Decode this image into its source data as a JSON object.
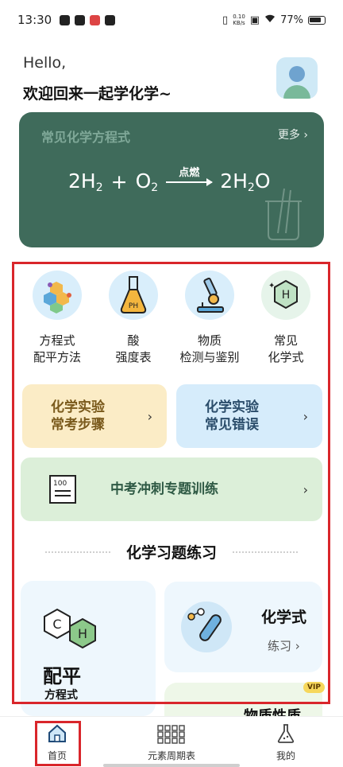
{
  "status_bar": {
    "time": "13:30",
    "net_speed_value": "0.10",
    "net_speed_unit": "KB/s",
    "battery": "77%"
  },
  "greeting": {
    "hello": "Hello,",
    "welcome": "欢迎回来一起学化学~"
  },
  "banner": {
    "title": "常见化学方程式",
    "more": "更多 ›",
    "condition": "点燃",
    "lhs1": "2H",
    "lhs1_sub": "2",
    "plus": "+",
    "lhs2": "O",
    "lhs2_sub": "2",
    "rhs": "2H",
    "rhs_sub": "2",
    "rhs_tail": "O"
  },
  "categories": [
    {
      "line1": "方程式",
      "line2": "配平方法",
      "icon": "molecule-hex-icon"
    },
    {
      "line1": "酸",
      "line2": "强度表",
      "icon": "ph-flask-icon"
    },
    {
      "line1": "物质",
      "line2": "检测与鉴别",
      "icon": "microscope-icon"
    },
    {
      "line1": "常见",
      "line2": "化学式",
      "icon": "hydrogen-hex-icon"
    }
  ],
  "cards": {
    "yellow_line1": "化学实验",
    "yellow_line2": "常考步骤",
    "blue_line1": "化学实验",
    "blue_line2": "常见错误",
    "green": "中考冲刺专题训练",
    "doc_number": "100",
    "chevron": "›"
  },
  "section": {
    "title": "化学习题练习"
  },
  "practice": {
    "left_title": "配平",
    "left_sub": "方程式",
    "hex_c": "C",
    "hex_h": "H",
    "right_title": "化学式",
    "right_sub": "练习 ›",
    "vip": "VIP",
    "partial_title": "物质性质"
  },
  "nav": {
    "home": "首页",
    "periodic": "元素周期表",
    "mine": "我的"
  },
  "colors": {
    "banner_bg": "#3f6b5b",
    "highlight_red": "#d9262b",
    "yellow_card": "#fbecc6",
    "blue_card": "#d6ecfb",
    "green_card": "#dcefd9"
  }
}
